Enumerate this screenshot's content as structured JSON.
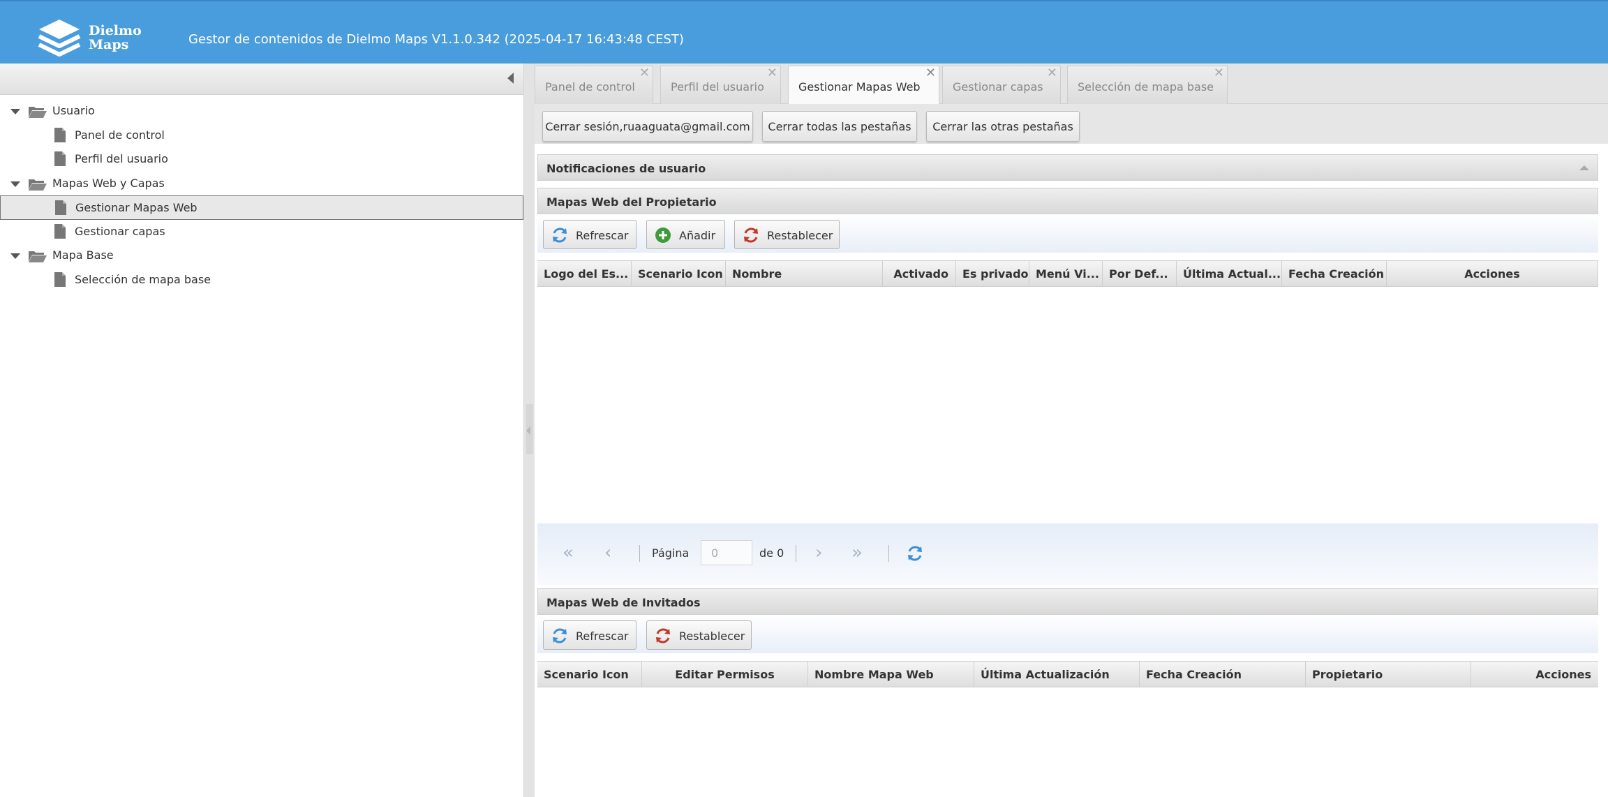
{
  "header": {
    "logo_text_line1": "Dielmo",
    "logo_text_line2": "Maps",
    "title": "Gestor de contenidos de Dielmo Maps V1.1.0.342 (2025-04-17 16:43:48 CEST)"
  },
  "tree": {
    "items": [
      {
        "label": "Usuario"
      },
      {
        "label": "Panel de control"
      },
      {
        "label": "Perfil del usuario"
      },
      {
        "label": "Mapas Web y Capas"
      },
      {
        "label": "Gestionar Mapas Web"
      },
      {
        "label": "Gestionar capas"
      },
      {
        "label": "Mapa Base"
      },
      {
        "label": "Selección de mapa base"
      }
    ]
  },
  "tabs": [
    {
      "label": "Panel de control"
    },
    {
      "label": "Perfil del usuario"
    },
    {
      "label": "Gestionar Mapas Web"
    },
    {
      "label": "Gestionar capas"
    },
    {
      "label": "Selección de mapa base"
    }
  ],
  "tab_close_glyph": "✕",
  "actions": {
    "logout": "Cerrar sesión,ruaaguata@gmail.com",
    "close_all": "Cerrar todas las pestañas",
    "close_others": "Cerrar las otras pestañas"
  },
  "notifications": {
    "title": "Notificaciones de usuario"
  },
  "owner_maps": {
    "title": "Mapas Web del Propietario",
    "refresh": "Refrescar",
    "add": "Añadir",
    "reset": "Restablecer",
    "columns": [
      "Logo del Es...",
      "Scenario Icon",
      "Nombre",
      "Activado",
      "Es privado",
      "Menú Vi...",
      "Por Def...",
      "Última Actual...",
      "Fecha Creación",
      "Acciones"
    ]
  },
  "pager": {
    "page_label": "Página",
    "page_value": "0",
    "of_label": "de 0"
  },
  "guest_maps": {
    "title": "Mapas Web de Invitados",
    "refresh": "Refrescar",
    "reset": "Restablecer",
    "columns": [
      "Scenario Icon",
      "Editar Permisos",
      "Nombre Mapa Web",
      "Última Actualización",
      "Fecha Creación",
      "Propietario",
      "Acciones"
    ]
  },
  "colors": {
    "header_blue": "#4a9ddc",
    "refresh_blue": "#3a8fd6",
    "add_green": "#3d9a3d",
    "reset_red": "#c0392b"
  }
}
